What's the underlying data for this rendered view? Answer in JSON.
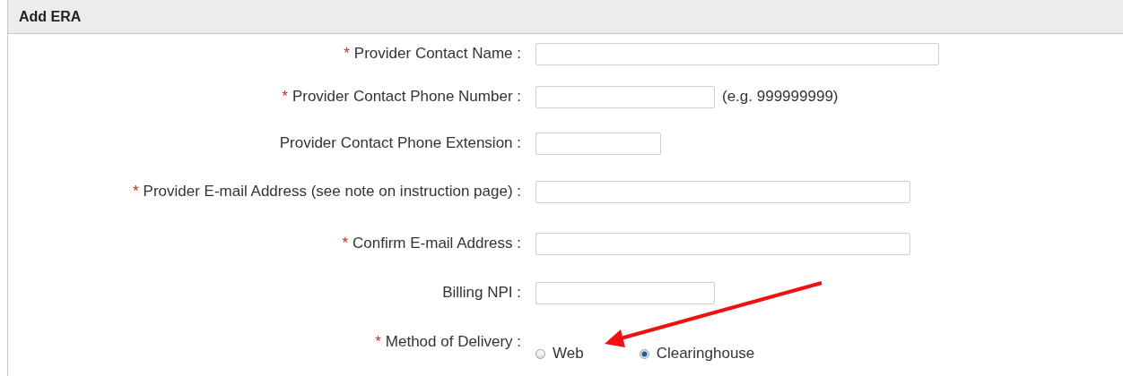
{
  "panel": {
    "title": "Add ERA"
  },
  "fields": [
    {
      "kind": "text",
      "label": "Provider Contact Name :",
      "asterisk": "*"
    },
    {
      "kind": "text",
      "label": "Provider Contact Phone Number :",
      "asterisk": "*",
      "hint": "(e.g. 999999999)"
    },
    {
      "kind": "text",
      "label": "Provider Contact Phone Extension :"
    },
    {
      "kind": "text",
      "label": "Provider E-mail Address (see note on instruction page) :",
      "asterisk": "*"
    },
    {
      "kind": "text",
      "label": "Confirm E-mail Address :",
      "asterisk": "*"
    },
    {
      "kind": "text",
      "label": "Billing NPI :"
    },
    {
      "kind": "radio",
      "label": "Method of Delivery :",
      "asterisk": "*",
      "options": [
        {
          "label": "Web",
          "selected": false
        },
        {
          "label": "Clearinghouse",
          "selected": true
        }
      ]
    }
  ]
}
